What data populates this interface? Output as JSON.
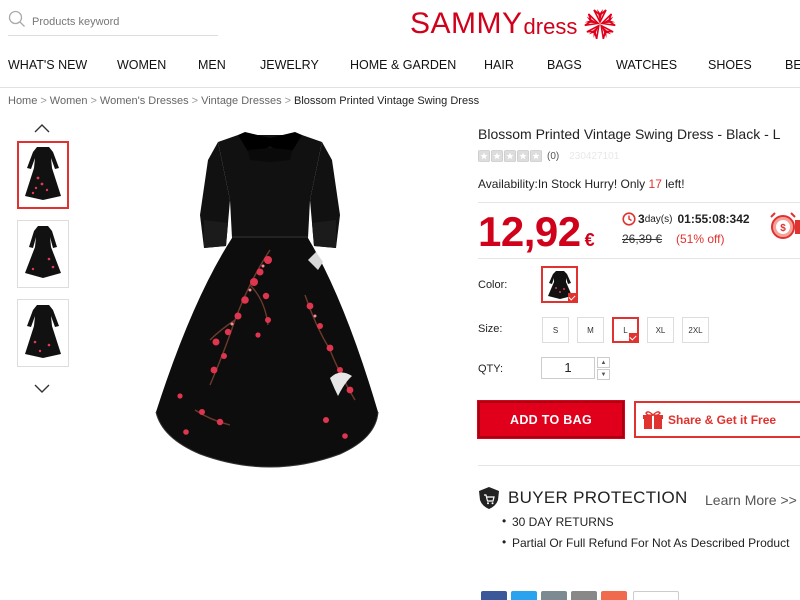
{
  "header": {
    "search_placeholder": "Products keyword",
    "brand_main": "SAMMY",
    "brand_sub": "dress",
    "brand_color": "#d0021b"
  },
  "nav": [
    "WHAT'S NEW",
    "WOMEN",
    "MEN",
    "JEWELRY",
    "HOME & GARDEN",
    "HAIR",
    "BAGS",
    "WATCHES",
    "SHOES",
    "BE"
  ],
  "breadcrumb": {
    "items": [
      "Home",
      "Women",
      "Women's Dresses",
      "Vintage Dresses"
    ],
    "current": "Blossom Printed Vintage Swing Dress",
    "separator": ">"
  },
  "gallery": {
    "thumb_count": 3,
    "selected": 0,
    "icons": [
      "chevron-up-icon",
      "chevron-down-icon"
    ]
  },
  "product": {
    "title": "Blossom Printed Vintage Swing Dress - Black - L",
    "rating_stars": 0,
    "review_count": "(0)",
    "sku": "230427101",
    "availability_label": "Availability:",
    "availability_text": "In Stock Hurry! Only",
    "stock_count": "17",
    "stock_suffix": "left!",
    "price": "12,92",
    "currency": "€",
    "timer_days": "3",
    "timer_days_label": "day(s)",
    "timer_clock": "01:55:08:342",
    "old_price": "26,39 €",
    "discount": "(51% off)",
    "color_label": "Color:",
    "size_label": "Size:",
    "sizes": [
      "S",
      "M",
      "L",
      "XL",
      "2XL"
    ],
    "selected_size": "L",
    "qty_label": "QTY:",
    "qty_value": "1",
    "add_to_bag": "ADD TO BAG",
    "share": "Share & Get it Free"
  },
  "buyer_protection": {
    "title": "BUYER PROTECTION",
    "learn_more": "Learn More >>",
    "items": [
      "30 DAY RETURNS",
      "Partial Or Full Refund For Not As Described Product"
    ]
  },
  "colors": {
    "accent": "#e0322e",
    "primary_red": "#d0021b"
  }
}
